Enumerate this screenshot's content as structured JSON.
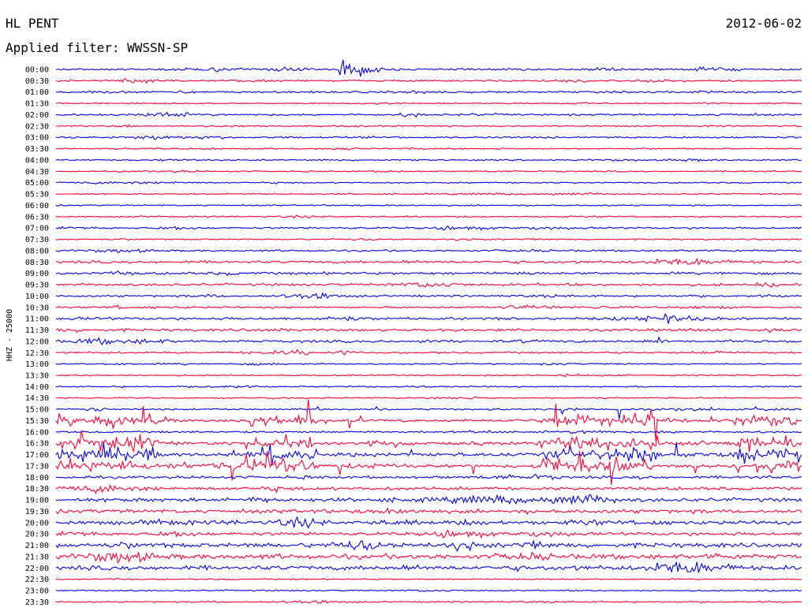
{
  "header": {
    "station": "HL PENT",
    "date": "2012-06-02",
    "filter": "Applied filter: WWSSN-SP"
  },
  "chart_data": {
    "type": "line",
    "ylabel": "HHZ - 25000",
    "trace_colors": [
      "#0000ee",
      "#ff0033"
    ],
    "rows": [
      {
        "label": "00:00",
        "activity": "quake",
        "level": 2
      },
      {
        "label": "00:30",
        "activity": "noise",
        "level": 2
      },
      {
        "label": "01:00",
        "activity": "noise",
        "level": 2
      },
      {
        "label": "01:30",
        "activity": "noise",
        "level": 1
      },
      {
        "label": "02:00",
        "activity": "noise",
        "level": 2
      },
      {
        "label": "02:30",
        "activity": "noise",
        "level": 1
      },
      {
        "label": "03:00",
        "activity": "noise",
        "level": 2
      },
      {
        "label": "03:30",
        "activity": "noise",
        "level": 1
      },
      {
        "label": "04:00",
        "activity": "noise",
        "level": 1
      },
      {
        "label": "04:30",
        "activity": "noise",
        "level": 1
      },
      {
        "label": "05:00",
        "activity": "noise",
        "level": 1
      },
      {
        "label": "05:30",
        "activity": "noise",
        "level": 1
      },
      {
        "label": "06:00",
        "activity": "noise",
        "level": 1
      },
      {
        "label": "06:30",
        "activity": "noise",
        "level": 1
      },
      {
        "label": "07:00",
        "activity": "noise",
        "level": 2
      },
      {
        "label": "07:30",
        "activity": "noise",
        "level": 1
      },
      {
        "label": "08:00",
        "activity": "noise",
        "level": 2
      },
      {
        "label": "08:30",
        "activity": "noise",
        "level": 3
      },
      {
        "label": "09:00",
        "activity": "noise",
        "level": 3
      },
      {
        "label": "09:30",
        "activity": "noise",
        "level": 3
      },
      {
        "label": "10:00",
        "activity": "noise",
        "level": 2
      },
      {
        "label": "10:30",
        "activity": "noise",
        "level": 2
      },
      {
        "label": "11:00",
        "activity": "noise",
        "level": 3
      },
      {
        "label": "11:30",
        "activity": "noise",
        "level": 3
      },
      {
        "label": "12:00",
        "activity": "noise",
        "level": 3
      },
      {
        "label": "12:30",
        "activity": "noise",
        "level": 2
      },
      {
        "label": "13:00",
        "activity": "noise",
        "level": 1
      },
      {
        "label": "13:30",
        "activity": "noise",
        "level": 1
      },
      {
        "label": "14:00",
        "activity": "noise",
        "level": 1
      },
      {
        "label": "14:30",
        "activity": "noise",
        "level": 1
      },
      {
        "label": "15:00",
        "activity": "spikes",
        "level": 2
      },
      {
        "label": "15:30",
        "activity": "burst",
        "level": 3
      },
      {
        "label": "16:00",
        "activity": "noise",
        "level": 2
      },
      {
        "label": "16:30",
        "activity": "burst",
        "level": 5
      },
      {
        "label": "17:00",
        "activity": "burst",
        "level": 5
      },
      {
        "label": "17:30",
        "activity": "burst",
        "level": 4
      },
      {
        "label": "18:00",
        "activity": "noise",
        "level": 3
      },
      {
        "label": "18:30",
        "activity": "noise",
        "level": 4
      },
      {
        "label": "19:00",
        "activity": "noise",
        "level": 5
      },
      {
        "label": "19:30",
        "activity": "noise",
        "level": 5
      },
      {
        "label": "20:00",
        "activity": "noise",
        "level": 5
      },
      {
        "label": "20:30",
        "activity": "noise",
        "level": 4
      },
      {
        "label": "21:00",
        "activity": "noise",
        "level": 6
      },
      {
        "label": "21:30",
        "activity": "noise",
        "level": 7
      },
      {
        "label": "22:00",
        "activity": "noise",
        "level": 6
      },
      {
        "label": "22:30",
        "activity": "noise",
        "level": 1
      },
      {
        "label": "23:00",
        "activity": "noise",
        "level": 1
      },
      {
        "label": "23:30",
        "activity": "noise",
        "level": 1
      }
    ]
  }
}
